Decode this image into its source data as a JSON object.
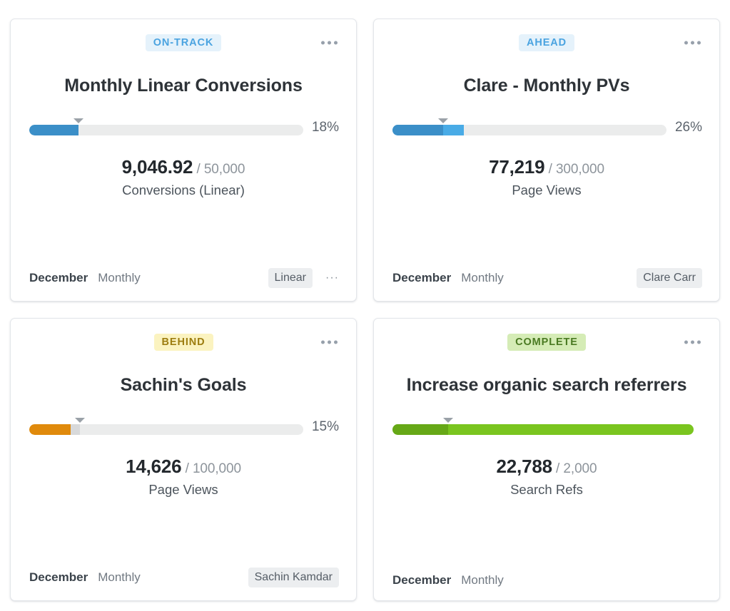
{
  "page": {
    "background": "#ffffff",
    "layout": "2x2 goal card grid"
  },
  "status_styles": {
    "on-track": {
      "label": "ON-TRACK",
      "text_color": "#4aa3e0",
      "bg_color": "#e5f2fb"
    },
    "ahead": {
      "label": "AHEAD",
      "text_color": "#4aa3e0",
      "bg_color": "#e5f2fb"
    },
    "behind": {
      "label": "BEHIND",
      "text_color": "#9d7d10",
      "bg_color": "#fbf3c0"
    },
    "complete": {
      "label": "COMPLETE",
      "text_color": "#4a7a22",
      "bg_color": "#d5ecb6"
    }
  },
  "cards": [
    {
      "status": "ON-TRACK",
      "status_text_color": "#4aa3e0",
      "status_bg_color": "#e5f2fb",
      "menu_icon": "kebab-menu-icon",
      "title": "Monthly Linear Conversions",
      "progress": {
        "percent_label": "18%",
        "percent_value": 18,
        "marker_percent": 18,
        "primary_color": "#3b8fc8",
        "extra_color": "#3b8fc8",
        "track_color": "#ebecec",
        "marker_color": "#9aa1a8"
      },
      "metric": {
        "value": "9,046.92",
        "separator": "/",
        "target": "50,000",
        "unit": "Conversions (Linear)"
      },
      "footer": {
        "period": "December",
        "cadence": "Monthly",
        "tag": "Linear",
        "more": "···"
      }
    },
    {
      "status": "AHEAD",
      "status_text_color": "#4aa3e0",
      "status_bg_color": "#e5f2fb",
      "menu_icon": "kebab-menu-icon",
      "title": "Clare - Monthly PVs",
      "progress": {
        "percent_label": "26%",
        "percent_value": 26,
        "marker_percent": 18.5,
        "primary_color": "#3b8fc8",
        "extra_color": "#49abe6",
        "track_color": "#ebecec",
        "marker_color": "#9aa1a8"
      },
      "metric": {
        "value": "77,219",
        "separator": "/",
        "target": "300,000",
        "unit": "Page Views"
      },
      "footer": {
        "period": "December",
        "cadence": "Monthly",
        "tag": "Clare Carr",
        "more": ""
      }
    },
    {
      "status": "BEHIND",
      "status_text_color": "#9d7d10",
      "status_bg_color": "#fbf3c0",
      "menu_icon": "kebab-menu-icon",
      "title": "Sachin's Goals",
      "progress": {
        "percent_label": "15%",
        "percent_value": 15,
        "marker_percent": 18.5,
        "primary_color": "#e08a0c",
        "extra_color": "#d8d9da",
        "track_color": "#ebecec",
        "marker_color": "#9aa1a8"
      },
      "metric": {
        "value": "14,626",
        "separator": "/",
        "target": "100,000",
        "unit": "Page Views"
      },
      "footer": {
        "period": "December",
        "cadence": "Monthly",
        "tag": "Sachin Kamdar",
        "more": ""
      }
    },
    {
      "status": "COMPLETE",
      "status_text_color": "#4a7a22",
      "status_bg_color": "#d5ecb6",
      "menu_icon": "kebab-menu-icon",
      "title": "Increase organic search referrers",
      "progress": {
        "percent_label": "",
        "percent_value": 100,
        "marker_percent": 18.5,
        "primary_color": "#66a817",
        "extra_color": "#7ac51f",
        "track_color": "#ebecec",
        "marker_color": "#9aa1a8"
      },
      "metric": {
        "value": "22,788",
        "separator": "/",
        "target": "2,000",
        "unit": "Search Refs"
      },
      "footer": {
        "period": "December",
        "cadence": "Monthly",
        "tag": "",
        "more": ""
      }
    }
  ]
}
